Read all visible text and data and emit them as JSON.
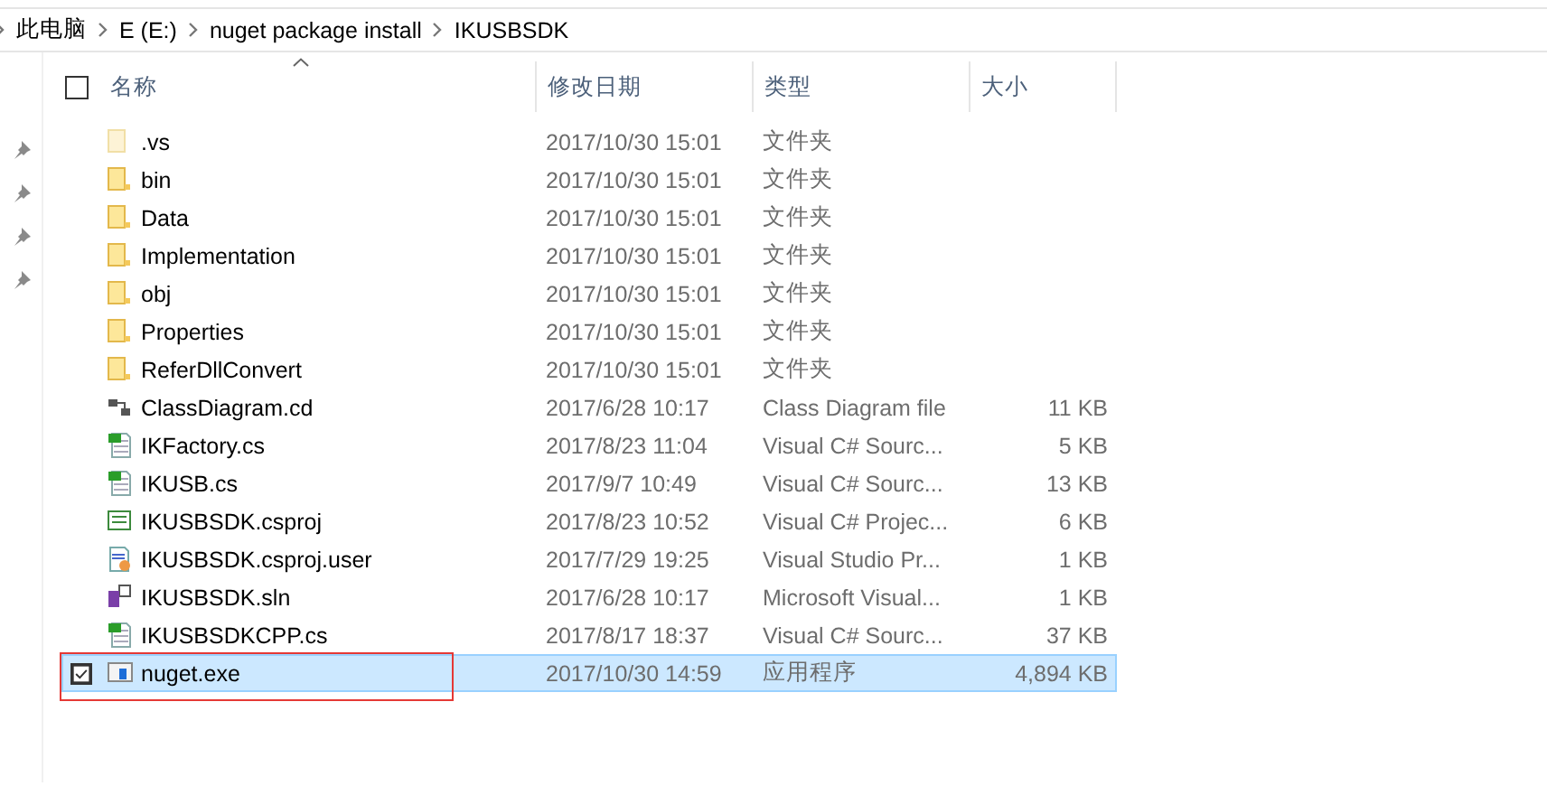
{
  "breadcrumb": [
    "此电脑",
    "E (E:)",
    "nuget package install",
    "IKUSBSDK"
  ],
  "select_all": {
    "checked": false
  },
  "columns": [
    {
      "label": "名称",
      "sorted": true
    },
    {
      "label": "修改日期",
      "sorted": false
    },
    {
      "label": "类型",
      "sorted": false
    },
    {
      "label": "大小",
      "sorted": false
    }
  ],
  "rows": [
    {
      "name": ".vs",
      "date": "2017/10/30 15:01",
      "type": "文件夹",
      "kind": "hidden-folder",
      "selected": false,
      "annotated": false
    },
    {
      "name": "bin",
      "date": "2017/10/30 15:01",
      "type": "文件夹",
      "kind": "folder",
      "selected": false,
      "annotated": false
    },
    {
      "name": "Data",
      "date": "2017/10/30 15:01",
      "type": "文件夹",
      "kind": "folder",
      "selected": false,
      "annotated": false
    },
    {
      "name": "Implementation",
      "date": "2017/10/30 15:01",
      "type": "文件夹",
      "kind": "folder",
      "selected": false,
      "annotated": false
    },
    {
      "name": "obj",
      "date": "2017/10/30 15:01",
      "type": "文件夹",
      "kind": "folder",
      "selected": false,
      "annotated": false
    },
    {
      "name": "Properties",
      "date": "2017/10/30 15:01",
      "type": "文件夹",
      "kind": "folder",
      "selected": false,
      "annotated": false
    },
    {
      "name": "ReferDllConvert",
      "date": "2017/10/30 15:01",
      "type": "文件夹",
      "kind": "folder",
      "selected": false,
      "annotated": false
    },
    {
      "name": "ClassDiagram.cd",
      "date": "2017/6/28 10:17",
      "type": "Class Diagram file",
      "size": "11 KB",
      "kind": "diagram",
      "selected": false,
      "annotated": false
    },
    {
      "name": "IKFactory.cs",
      "date": "2017/8/23 11:04",
      "type": "Visual C# Sourc...",
      "size": "5 KB",
      "kind": "cs",
      "selected": false,
      "annotated": false
    },
    {
      "name": "IKUSB.cs",
      "date": "2017/9/7 10:49",
      "type": "Visual C# Sourc...",
      "size": "13 KB",
      "kind": "cs",
      "selected": false,
      "annotated": false
    },
    {
      "name": "IKUSBSDK.csproj",
      "date": "2017/8/23 10:52",
      "type": "Visual C# Projec...",
      "size": "6 KB",
      "kind": "csproj",
      "selected": false,
      "annotated": false
    },
    {
      "name": "IKUSBSDK.csproj.user",
      "date": "2017/7/29 19:25",
      "type": "Visual Studio Pr...",
      "size": "1 KB",
      "kind": "user",
      "selected": false,
      "annotated": false
    },
    {
      "name": "IKUSBSDK.sln",
      "date": "2017/6/28 10:17",
      "type": "Microsoft Visual...",
      "size": "1 KB",
      "kind": "sln",
      "selected": false,
      "annotated": false
    },
    {
      "name": "IKUSBSDKCPP.cs",
      "date": "2017/8/17 18:37",
      "type": "Visual C# Sourc...",
      "size": "37 KB",
      "kind": "cs",
      "selected": false,
      "annotated": false
    },
    {
      "name": "nuget.exe",
      "date": "2017/10/30 14:59",
      "type": "应用程序",
      "size": "4,894 KB",
      "kind": "exe",
      "selected": true,
      "annotated": true
    }
  ]
}
